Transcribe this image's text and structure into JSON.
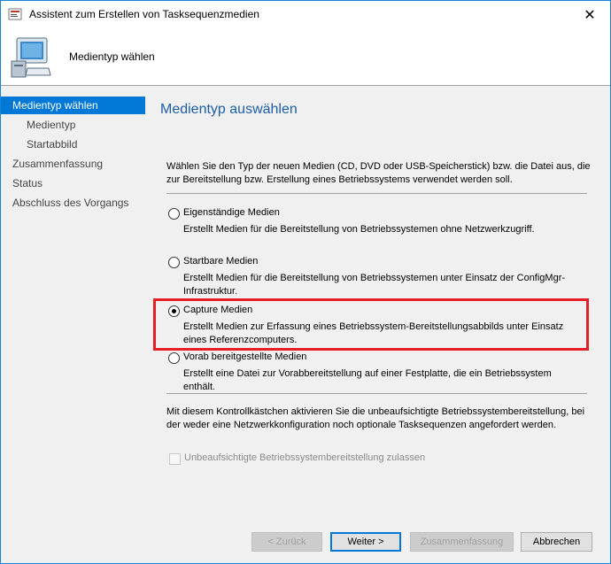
{
  "window": {
    "title": "Assistent zum Erstellen von Tasksequenzmedien",
    "close_label": "✕"
  },
  "header": {
    "title": "Medientyp wählen"
  },
  "nav": {
    "items": [
      {
        "label": "Medientyp wählen",
        "active": true,
        "sub": false
      },
      {
        "label": "Medientyp",
        "active": false,
        "sub": true
      },
      {
        "label": "Startabbild",
        "active": false,
        "sub": true
      },
      {
        "label": "Zusammenfassung",
        "active": false,
        "sub": false
      },
      {
        "label": "Status",
        "active": false,
        "sub": false
      },
      {
        "label": "Abschluss des Vorgangs",
        "active": false,
        "sub": false
      }
    ]
  },
  "content": {
    "title": "Medientyp auswählen",
    "intro": "Wählen Sie den Typ der neuen Medien (CD, DVD oder USB-Speicherstick) bzw. die Datei aus, die zur Bereitstellung bzw. Erstellung eines Betriebssystems verwendet werden soll.",
    "options": [
      {
        "label": "Eigenständige Medien",
        "desc": "Erstellt Medien für die Bereitstellung von Betriebssystemen ohne Netzwerkzugriff.",
        "checked": false
      },
      {
        "label": "Startbare Medien",
        "desc": "Erstellt Medien für die Bereitstellung von Betriebssystemen unter Einsatz der ConfigMgr-Infrastruktur.",
        "checked": false
      },
      {
        "label": "Capture Medien",
        "desc": "Erstellt Medien zur Erfassung eines Betriebssystem-Bereitstellungsabbilds unter Einsatz eines Referenzcomputers.",
        "checked": true
      },
      {
        "label": "Vorab bereitgestellte Medien",
        "desc": "Erstellt eine Datei zur Vorabbereitstellung auf einer Festplatte, die ein Betriebssystem enthält.",
        "checked": false
      }
    ],
    "note": "Mit diesem Kontrollkästchen aktivieren Sie die unbeaufsichtigte Betriebssystembereitstellung, bei der weder eine Netzwerkkonfiguration noch optionale Tasksequenzen angefordert werden.",
    "checkbox_label": "Unbeaufsichtigte Betriebssystembereitstellung zulassen"
  },
  "footer": {
    "back_label": "< Zurück",
    "next_label": "Weiter >",
    "summary_label": "Zusammenfassung",
    "cancel_label": "Abbrechen"
  },
  "colors": {
    "accent": "#0078d7",
    "title_blue": "#1c5fa8",
    "highlight_red": "#e32026"
  }
}
